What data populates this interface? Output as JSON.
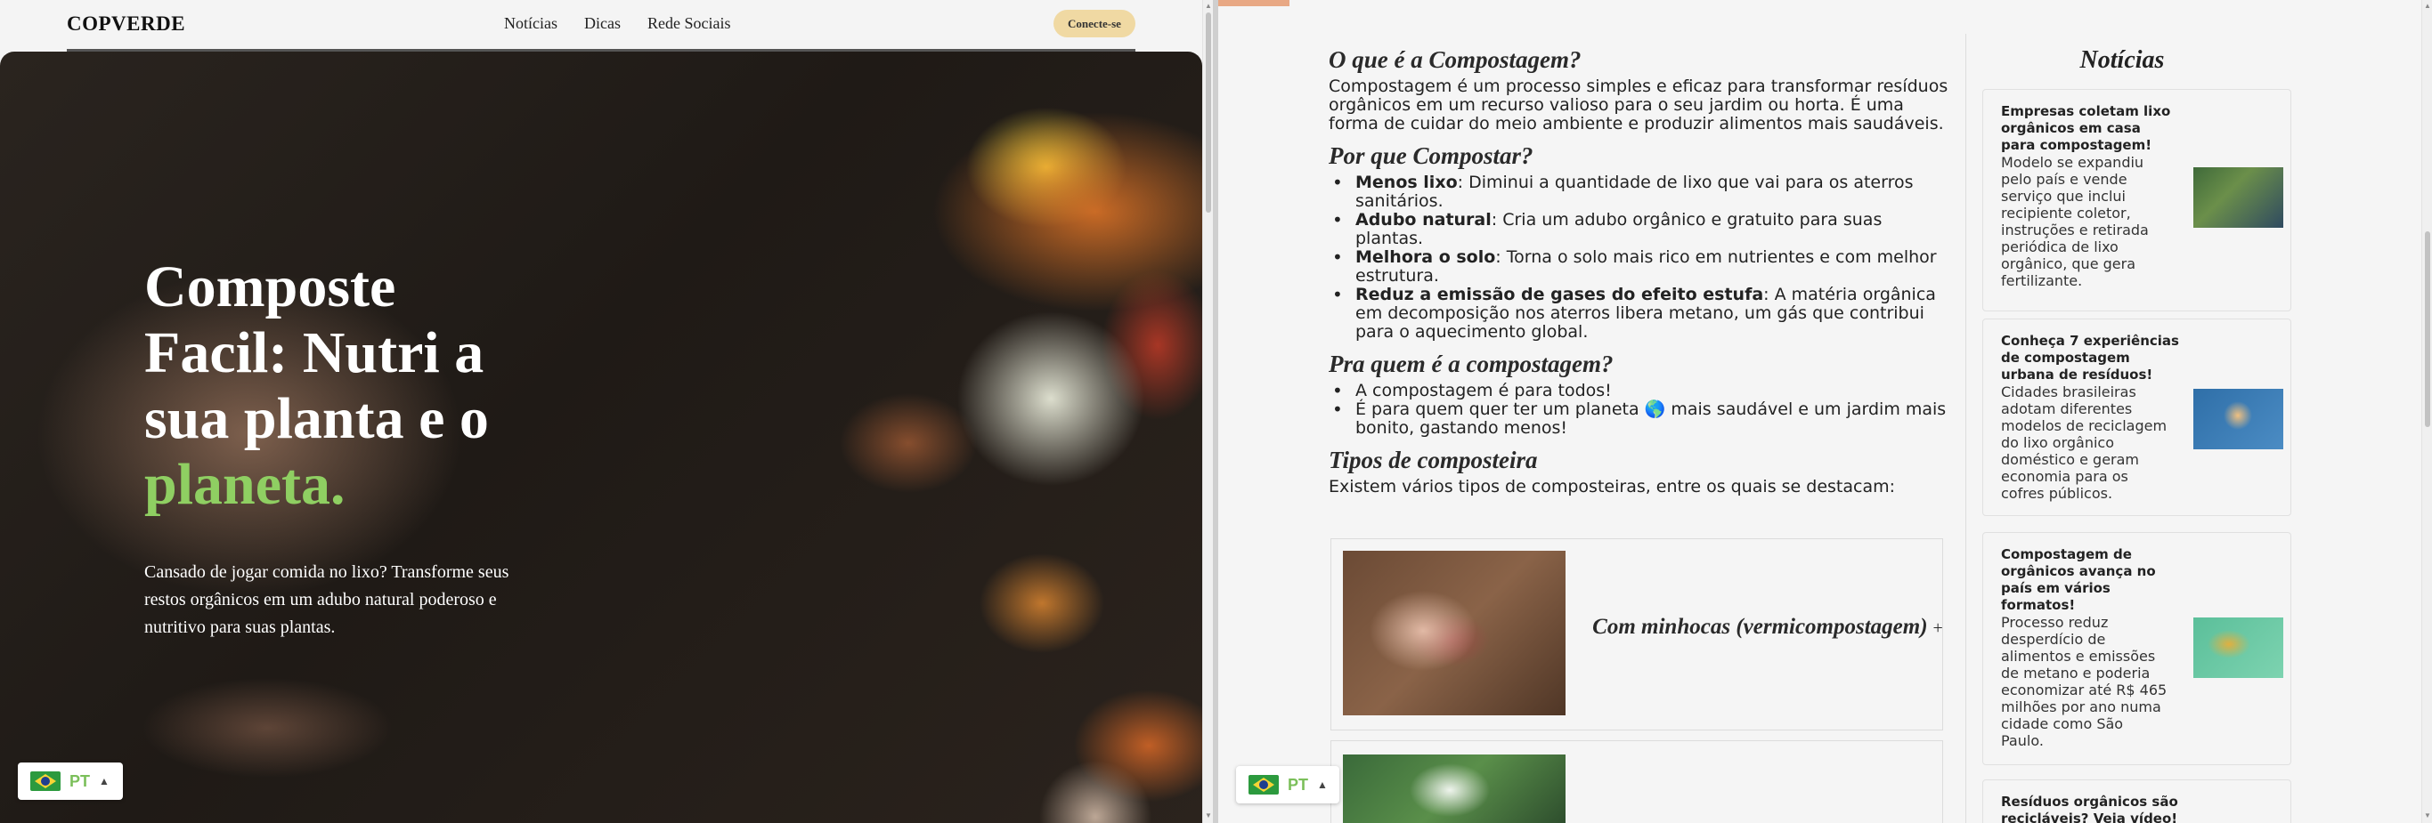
{
  "left": {
    "brand": "COPVERDE",
    "nav": [
      "Notícias",
      "Dicas",
      "Rede Sociais"
    ],
    "connect": "Conecte-se",
    "hero": {
      "title_line1": "Composte",
      "title_line2": "Facil: Nutri a",
      "title_line3": "sua planta e o",
      "title_accent": "planeta.",
      "subtitle": "Cansado de jogar comida no lixo? Transforme seus restos orgânicos em um adubo natural poderoso e nutritivo para suas plantas."
    },
    "lang": "PT"
  },
  "right": {
    "s1": {
      "title": "O que é a Compostagem?",
      "text": "Compostagem é um processo simples e eficaz para transformar resíduos orgânicos em um recurso valioso para o seu jardim ou horta. É uma forma de cuidar do meio ambiente e produzir alimentos mais saudáveis."
    },
    "s2": {
      "title": "Por que Compostar?",
      "items": [
        {
          "bold": "Menos lixo",
          "text": ": Diminui a quantidade de lixo que vai para os aterros sanitários."
        },
        {
          "bold": "Adubo natural",
          "text": ": Cria um adubo orgânico e gratuito para suas plantas."
        },
        {
          "bold": "Melhora o solo",
          "text": ": Torna o solo mais rico em nutrientes e com melhor estrutura."
        },
        {
          "bold": "Reduz a emissão de gases do efeito estufa",
          "text": ": A matéria orgânica em decomposição nos aterros libera metano, um gás que contribui para o aquecimento global."
        }
      ]
    },
    "s3": {
      "title": "Pra quem é a compostagem?",
      "items": [
        "A compostagem é para todos!",
        "É para quem quer ter um planeta 🌎 mais saudável e um jardim mais bonito, gastando menos!"
      ]
    },
    "s4": {
      "title": "Tipos de composteira",
      "text": "Existem vários tipos de composteiras, entre os quais se destacam:",
      "card1_title": "Com minhocas (vermicompostagem)",
      "card1_plus": "+"
    },
    "news": {
      "heading": "Notícias",
      "items": [
        {
          "title": "Empresas coletam lixo orgânicos em casa para compostagem!",
          "desc": "Modelo se expandiu pelo país e vende serviço que inclui recipiente coletor, instruções e retirada periódica de lixo orgânico, que gera fertilizante."
        },
        {
          "title": "Conheça 7 experiências de compostagem urbana de resíduos!",
          "desc": "Cidades brasileiras adotam diferentes modelos de reciclagem do lixo orgânico doméstico e geram economia para os cofres públicos."
        },
        {
          "title": "Compostagem de orgânicos avança no país em vários formatos!",
          "desc": "Processo reduz desperdício de alimentos e emissões de metano e poderia economizar até R$ 465 milhões por ano numa cidade como São Paulo."
        },
        {
          "title": "Resíduos orgânicos são recicláveis? Veja vídeo!",
          "desc": ""
        }
      ]
    },
    "lang": "PT"
  }
}
